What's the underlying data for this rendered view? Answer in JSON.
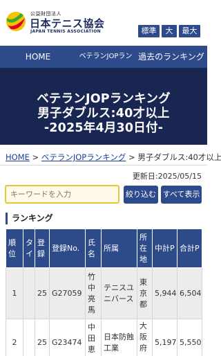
{
  "header": {
    "org_small": "公益財団法人",
    "org_name": "日本テニス協会",
    "org_en": "JAPAN TENNIS ASSOCIATION",
    "font_size_buttons": [
      "標準",
      "大",
      "最大"
    ]
  },
  "nav": {
    "items": [
      "HOME",
      "ベテランJOPランキング",
      "過去のランキング"
    ]
  },
  "banner": {
    "line1": "ベテランJOPランキング",
    "line2": "男子ダブルス:40才以上",
    "line3": "-2025年4月30日付-"
  },
  "breadcrumb": {
    "home": "HOME",
    "sep1": ">",
    "ranking": "ベテランJOPランキング",
    "sep2": ">",
    "current": "男子ダブルス:40才以上"
  },
  "updated": "更新日:2025/05/15",
  "search": {
    "placeholder": "キーワードを入力",
    "filter_button": "絞り込む",
    "show_all_button": "すべて表示"
  },
  "section_title": "ランキング",
  "table": {
    "headers": [
      "順位",
      "タイ",
      "登録",
      "登録No.",
      "氏名",
      "所属",
      "所在地",
      "中計P",
      "合計P"
    ],
    "rows": [
      {
        "rank": "1",
        "tie": "",
        "reg": "25",
        "reg_no": "G27059",
        "name": "竹中亮馬",
        "affiliation": "テニスユニバース",
        "location": "東京都",
        "subtotal": "5,944",
        "total": "6,504"
      },
      {
        "rank": "2",
        "tie": "",
        "reg": "25",
        "reg_no": "G23474",
        "name": "中田恵",
        "affiliation": "日本防蝕工業",
        "location": "大阪府",
        "subtotal": "5,197",
        "total": "5,550"
      }
    ]
  },
  "colors": {
    "navy": "#2d4a8a",
    "banner": "#1a2652",
    "search_border": "#e8c638"
  }
}
